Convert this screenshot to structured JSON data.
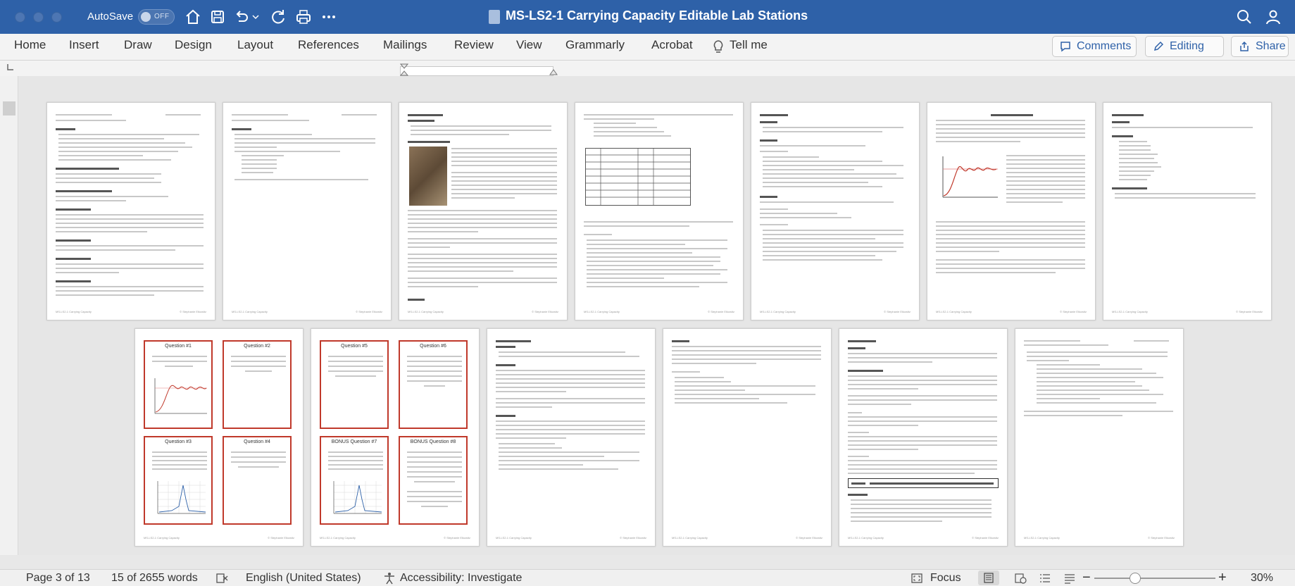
{
  "titlebar": {
    "autosave_label": "AutoSave",
    "autosave_state": "OFF",
    "document_title": "MS-LS2-1 Carrying Capacity Editable Lab Stations",
    "colors": {
      "bar": "#2e61a8"
    }
  },
  "ribbon": {
    "tabs": [
      "Home",
      "Insert",
      "Draw",
      "Design",
      "Layout",
      "References",
      "Mailings",
      "Review",
      "View",
      "Grammarly",
      "Acrobat"
    ],
    "tell_me": "Tell me",
    "comments_label": "Comments",
    "editing_label": "Editing",
    "share_label": "Share"
  },
  "statusbar": {
    "page": "Page 3 of 13",
    "words": "15 of 2655 words",
    "language": "English (United States)",
    "accessibility": "Accessibility: Investigate",
    "focus": "Focus",
    "zoom": "30%"
  },
  "pages": {
    "row1": [
      "Carrying Capacity Lab Overview",
      "Carrying Capacity Pre Lab Assignment",
      "Science Skills Station",
      "Kaibab deer data table",
      "Narrative Station",
      "CARRYING CAPACITY",
      "Assessment Station"
    ],
    "row2": [
      "Question cards 1-4",
      "Question cards 5-8",
      "Problem-Solving Station",
      "Activity #2",
      "Synthesis Station",
      "Carrying Capacity Post-Lab Reflection"
    ],
    "questions": [
      "Question #1",
      "Question #2",
      "Question #3",
      "Question #4",
      "Question #5",
      "Question #6",
      "BONUS Question #7",
      "BONUS Question #8"
    ],
    "footer_left": "MS-LS2-1 Carrying Capacity",
    "footer_right": "© Stephanie Elkowitz"
  }
}
